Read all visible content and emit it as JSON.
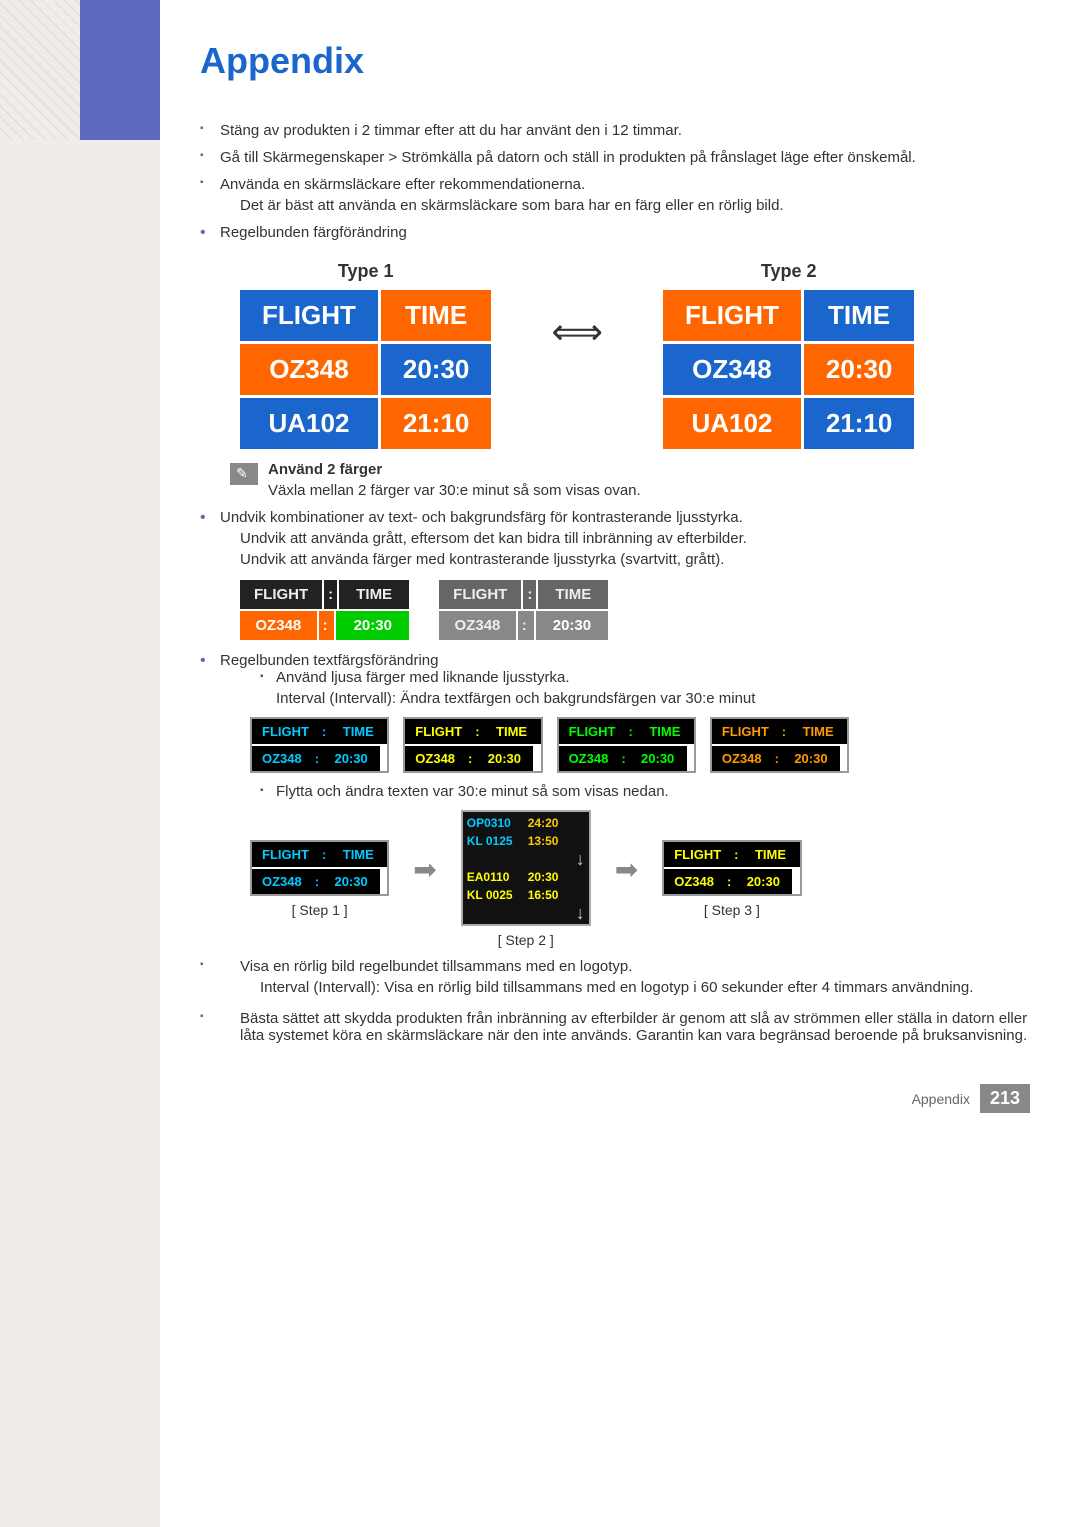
{
  "page": {
    "title": "Appendix",
    "footer_label": "Appendix",
    "footer_page": "213"
  },
  "content": {
    "bullet1": "Stäng av produkten i 2 timmar efter att du har använt den i 12 timmar.",
    "bullet2": "Gå till Skärmegenskaper > Strömkälla på datorn och ställ in produkten på frånslaget läge efter önskemål.",
    "bullet3": "Använda en skärmsläckare efter rekommendationerna.",
    "bullet3_sub": "Det är bäst att använda en skärmsläckare som bara har en färg eller en rörlig bild.",
    "bullet4": "Regelbunden färgförändring",
    "type1_label": "Type 1",
    "type2_label": "Type 2",
    "flight_label": "FLIGHT",
    "time_label": "TIME",
    "flight1": "OZ348",
    "time1": "20:30",
    "flight2": "UA102",
    "time2": "21:10",
    "note_text": "Använd 2 färger",
    "note_sub": "Växla mellan 2 färger var 30:e minut så som visas ovan.",
    "bullet5": "Undvik kombinationer av text- och bakgrundsfärg för kontrasterande ljusstyrka.",
    "bullet5_sub1": "Undvik att använda grått, eftersom det kan bidra till inbränning av efterbilder.",
    "bullet5_sub2": "Undvik att använda färger med kontrasterande ljusstyrka (svartvitt, grått).",
    "bullet6": "Regelbunden textfärgsförändring",
    "sub_bullet6_1": "Använd ljusa färger med liknande ljusstyrka.",
    "sub_bullet6_2": "Interval (Intervall): Ändra textfärgen och bakgrundsfärgen var 30:e minut",
    "sub_bullet6_3": "Flytta och ändra texten var 30:e minut så som visas nedan.",
    "step1_label": "[ Step 1 ]",
    "step2_label": "[ Step 2 ]",
    "step3_label": "[ Step 3 ]",
    "bullet7": "Visa en rörlig bild regelbundet tillsammans med en logotyp.",
    "bullet7_sub": "Interval (Intervall): Visa en rörlig bild tillsammans med en logotyp i 60 sekunder efter 4 timmars användning.",
    "bullet8": "Bästa sättet att skydda produkten från inbränning av efterbilder är genom att slå av strömmen eller ställa in datorn eller låta systemet köra en skärmsläckare när den inte används. Garantin kan vara begränsad beroende på bruksanvisning.",
    "color_boards": [
      {
        "flight_color": "#00ccff",
        "time_color": "#00ccff",
        "bg1": "#000",
        "bg2": "#000",
        "flight_val": "OZ348",
        "time_val": "20:30"
      },
      {
        "flight_color": "#ffff00",
        "time_color": "#ffff00",
        "bg1": "#000",
        "bg2": "#000",
        "flight_val": "OZ348",
        "time_val": "20:30"
      },
      {
        "flight_color": "#00ff00",
        "time_color": "#00ff00",
        "bg1": "#000",
        "bg2": "#000",
        "flight_val": "OZ348",
        "time_val": "20:30"
      },
      {
        "flight_color": "#ff9900",
        "time_color": "#ff9900",
        "bg1": "#000",
        "bg2": "#000",
        "flight_val": "OZ348",
        "time_val": "20:30"
      }
    ],
    "step2_rows": [
      {
        "flight": "OP0310",
        "time": "24:20"
      },
      {
        "flight": "KL 0125",
        "time": "13:50"
      },
      {
        "flight": "EA0110",
        "time": "20:30"
      },
      {
        "flight": "KL 0025",
        "time": "16:50"
      }
    ]
  }
}
